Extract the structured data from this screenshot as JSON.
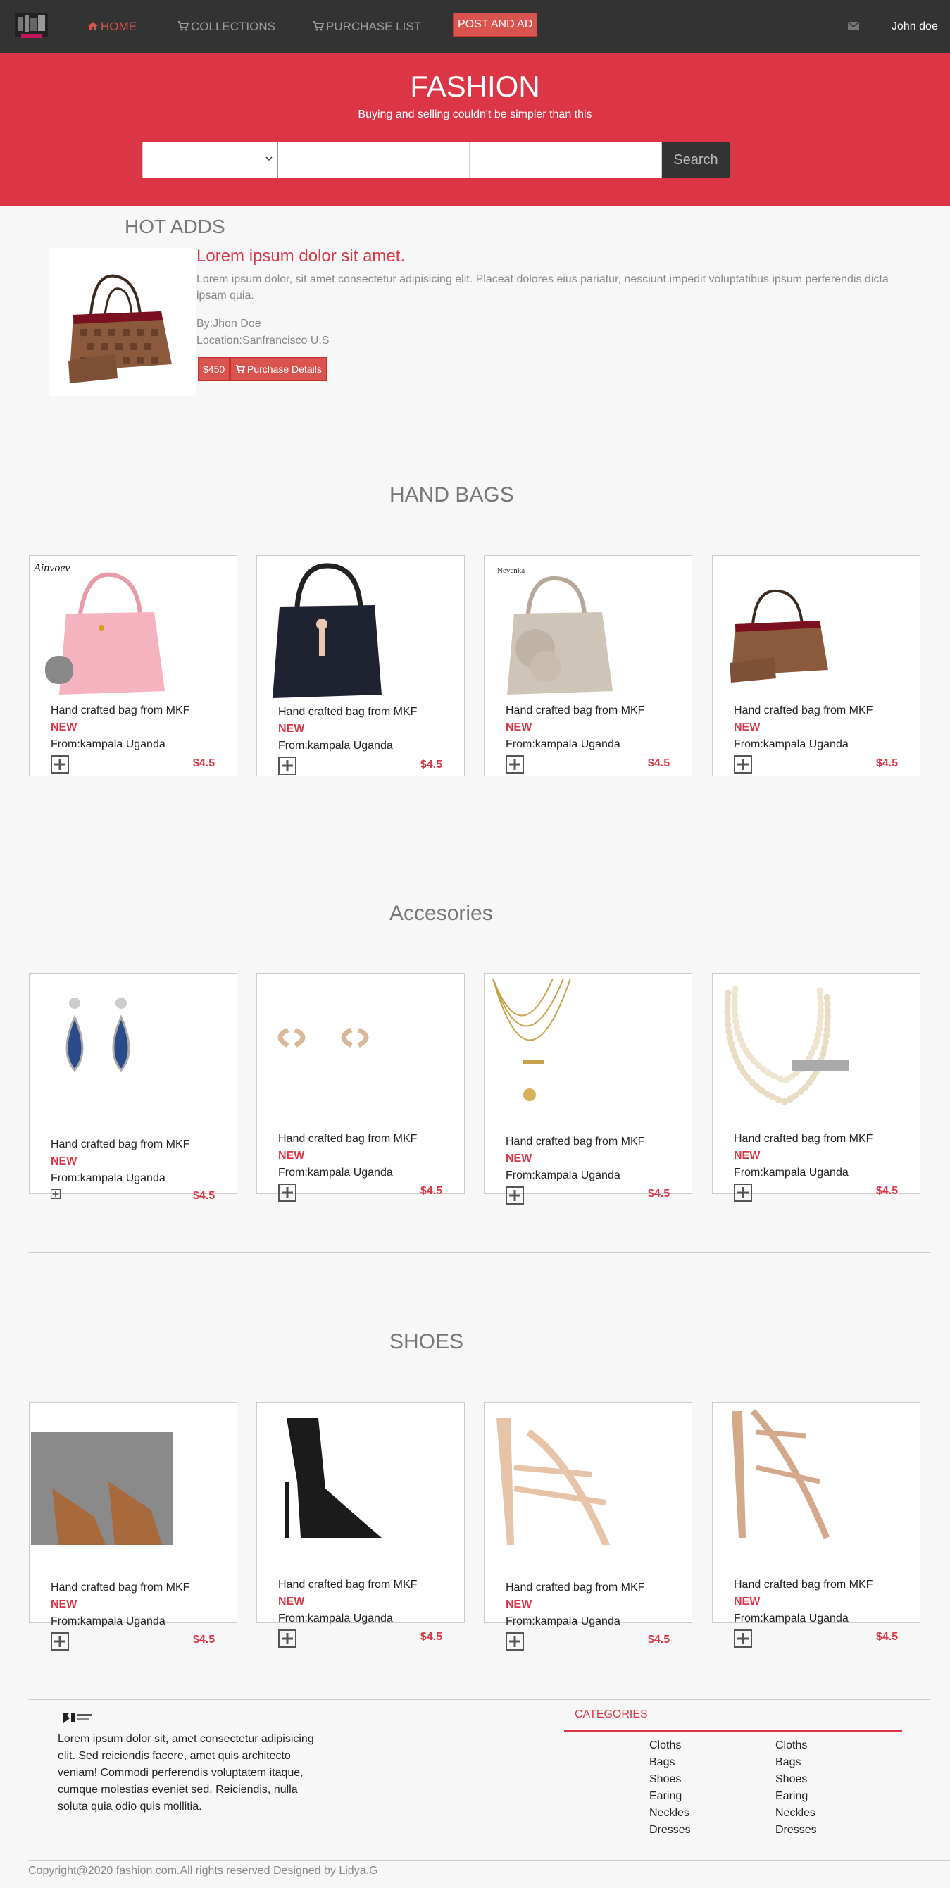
{
  "nav": {
    "home": "HOME",
    "collections": "COLLECTIONS",
    "purchase_list": "PURCHASE LIST",
    "post_ad": "POST AND AD",
    "user": "John doe"
  },
  "hero": {
    "title": "FASHION",
    "tagline": "Buying and selling couldn't be simpler than this",
    "search_button": "Search"
  },
  "hot": {
    "section_title": "HOT ADDS",
    "heading": "Lorem ipsum dolor sit amet.",
    "description": "Lorem ipsum dolor, sit amet consectetur adipisicing elit. Placeat dolores eius pariatur, nesciunt impedit voluptatibus ipsum perferendis dicta ipsam quia.",
    "by": "By:Jhon Doe",
    "location": "Location:Sanfrancisco U.S",
    "price": "$450",
    "details_button": "Purchase Details"
  },
  "sections": {
    "handbags": "HAND BAGS",
    "accessories": "Accesories",
    "shoes": "SHOES"
  },
  "card": {
    "title": "Hand crafted bag from MKF",
    "badge": "NEW",
    "from": "From:kampala Uganda",
    "price": "$4.5"
  },
  "footer": {
    "text": "Lorem ipsum dolor sit, amet consectetur adipisicing elit. Sed reiciendis facere, amet quis architecto veniam! Commodi perferendis voluptatem itaque, cumque molestias eveniet sed. Reiciendis, nulla soluta quia odio quis mollitia.",
    "categories_title": "CATEGORIES",
    "categories": [
      "Cloths",
      "Bags",
      "Shoes",
      "Earing",
      "Neckles",
      "Dresses"
    ],
    "copyright": "Copyright@2020 fashion.com.All rights reserved Designed by Lidya.G"
  },
  "colors": {
    "brand": "#dc3545",
    "navbar": "#333333",
    "background": "#f7f7f7"
  }
}
